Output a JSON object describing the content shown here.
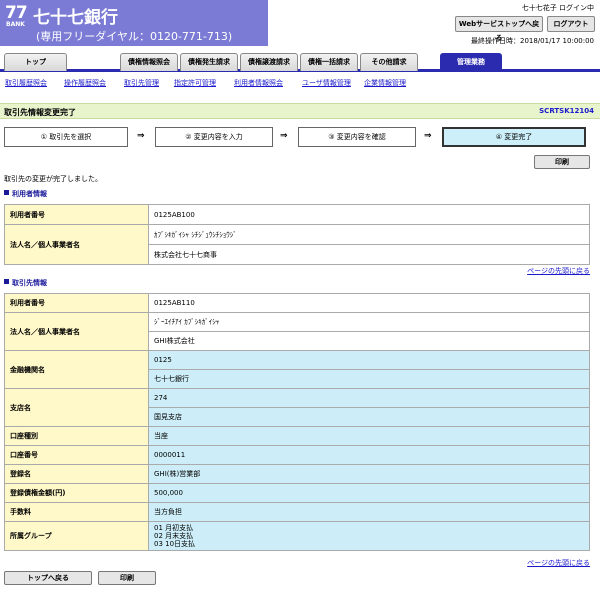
{
  "header": {
    "logo_number": "77",
    "logo_bank": "BANK",
    "bank_name": "七十七銀行",
    "phone": "(専用フリーダイヤル：0120-771-713)",
    "user_login": "七十七花子 ログイン中",
    "webtop_button": "Webサービストップへ戻る",
    "logout_button": "ログアウト",
    "last_operation": "最終操作日時：2018/01/17 10:00:00",
    "brand_color": "#7b7bd6"
  },
  "tabs": [
    {
      "label": "トップ"
    },
    {
      "label": "債権情報照会"
    },
    {
      "label": "債権発生請求"
    },
    {
      "label": "債権譲渡請求"
    },
    {
      "label": "債権一括請求"
    },
    {
      "label": "その他請求"
    },
    {
      "label": "管理業務"
    }
  ],
  "subnav": [
    {
      "label": "取引履歴照会"
    },
    {
      "label": "操作履歴照会"
    },
    {
      "label": "取引先管理"
    },
    {
      "label": "指定許可管理"
    },
    {
      "label": "利用者情報照会"
    },
    {
      "label": "ユーザ情報管理"
    },
    {
      "label": "企業情報管理"
    }
  ],
  "page": {
    "title": "取引先情報変更完了",
    "code": "SCRTSK12104",
    "message": "取引先の変更が完了しました。",
    "print_button": "印刷",
    "back_top_button": "トップへ戻る",
    "page_top_link": "ページの先頭に戻る"
  },
  "steps": [
    {
      "label": "① 取引先を選択"
    },
    {
      "label": "② 変更内容を入力"
    },
    {
      "label": "③ 変更内容を確認"
    },
    {
      "label": "④ 変更完了"
    }
  ],
  "arrow": "⇒",
  "user_info": {
    "heading": "利用者情報",
    "rows": [
      {
        "label": "利用者番号",
        "values": [
          "0125AB100"
        ]
      },
      {
        "label": "法人名／個人事業者名",
        "values": [
          "ｶﾌﾞｼｷｶﾞｲｼｬ ｼﾁｼﾞｭｳｼﾁｼｮｳｼﾞ",
          "株式会社七十七商事"
        ]
      }
    ]
  },
  "partner_info": {
    "heading": "取引先情報",
    "rows": [
      {
        "label": "利用者番号",
        "values": [
          "0125AB110"
        ]
      },
      {
        "label": "法人名／個人事業者名",
        "values": [
          "ｼﾞｰｴｲﾁｱｲ ｶﾌﾞｼｷｶﾞｲｼｬ",
          "GHI株式会社"
        ]
      },
      {
        "label": "金融機関名",
        "values": [
          "0125",
          "七十七銀行"
        ]
      },
      {
        "label": "支店名",
        "values": [
          "274",
          "国見支店"
        ]
      },
      {
        "label": "口座種別",
        "values": [
          "当座"
        ]
      },
      {
        "label": "口座番号",
        "values": [
          "0000011"
        ]
      },
      {
        "label": "登録名",
        "values": [
          "GHI(株)営業部"
        ]
      },
      {
        "label": "登録債権金額(円)",
        "values": [
          "500,000"
        ]
      },
      {
        "label": "手数料",
        "values": [
          "当方負担"
        ]
      },
      {
        "label": "所属グループ",
        "values": [
          "01 月初支払",
          "02 月末支払",
          "03 10日支払"
        ]
      }
    ]
  }
}
